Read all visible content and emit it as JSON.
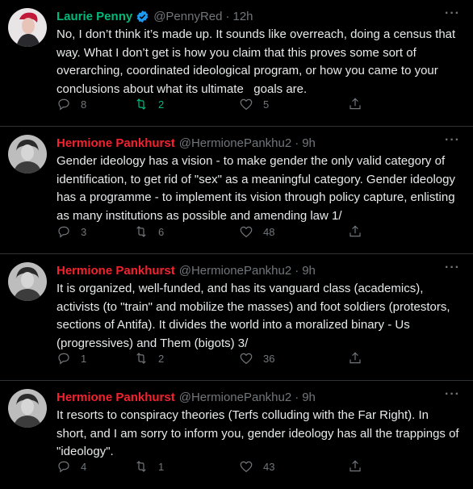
{
  "colors": {
    "background": "#000000",
    "text": "#e7e9ea",
    "muted": "#71767b",
    "pankhurst_name": "#f4212e",
    "penny_name": "#00ba7c",
    "verified": "#1d9bf0",
    "retweet_active": "#00ba7c"
  },
  "tweets": [
    {
      "name": "Laurie Penny",
      "verified": true,
      "handle": "@PennyRed",
      "time": "12h",
      "text": "No, I don’t think it’s made up. It sounds like overreach, doing a census that way. What I don’t get is how you claim that this proves some sort of overarching, coordinated ideological program, or how you came to your conclusions about what its ultimate   goals are.",
      "replies": "8",
      "retweets": "2",
      "likes": "5",
      "retweeted": true
    },
    {
      "name": "Hermione Pankhurst",
      "handle": "@HermionePankhu2",
      "time": "9h",
      "text": "Gender ideology has a vision - to make gender the only valid category of identification, to get rid of \"sex\" as a meaningful category. Gender ideology has a programme - to implement its vision through policy capture, enlisting as many institutions as possible and amending law 1/",
      "replies": "3",
      "retweets": "6",
      "likes": "48"
    },
    {
      "name": "Hermione Pankhurst",
      "handle": "@HermionePankhu2",
      "time": "9h",
      "text": "It is organized, well-funded, and has its vanguard class (academics), activists (to \"train\" and mobilize the masses) and foot soldiers (protestors, sections of Antifa). It divides the world into a moralized binary - Us (progressives) and Them (bigots) 3/",
      "replies": "1",
      "retweets": "2",
      "likes": "36"
    },
    {
      "name": "Hermione Pankhurst",
      "handle": "@HermionePankhu2",
      "time": "9h",
      "text": "It resorts to conspiracy theories (Terfs colluding with the Far Right). In short, and I am sorry to inform you, gender ideology has all the trappings of \"ideology\".",
      "replies": "4",
      "retweets": "1",
      "likes": "43"
    }
  ],
  "icons": {
    "reply": "reply-icon",
    "retweet": "retweet-icon",
    "like": "heart-icon",
    "share": "share-icon",
    "more": "more-icon",
    "verified": "verified-badge-icon"
  }
}
